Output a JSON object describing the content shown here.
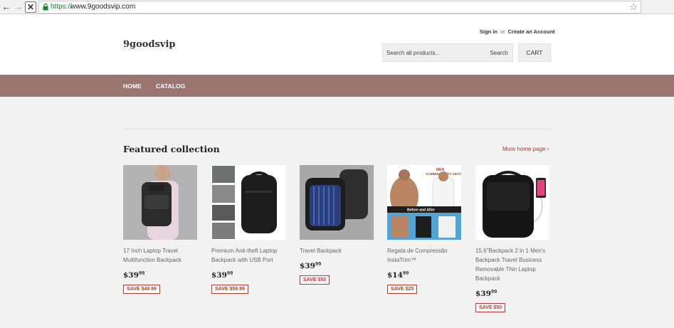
{
  "browser": {
    "url_scheme": "https://",
    "url_host": "www.9goodsvip.com",
    "back_icon": "back-arrow-icon",
    "forward_icon": "forward-arrow-icon",
    "stop_icon": "stop-icon",
    "bookmark_icon": "star-icon"
  },
  "header": {
    "logo": "9goodsvip",
    "sign_in": "Sign in",
    "or": "or",
    "create_account": "Create an Account",
    "search_placeholder": "Search all products...",
    "search_button": "Search",
    "cart": "CART"
  },
  "nav": {
    "items": [
      {
        "label": "HOME"
      },
      {
        "label": "CATALOG"
      }
    ],
    "background": "#9b7570"
  },
  "featured": {
    "title": "Featured collection",
    "more_link": "More home page ›",
    "products": [
      {
        "title": "17 Inch Laptop Travel Multifunction Backpack",
        "price_main": "$39",
        "price_cents": "99",
        "save": "SAVE $49.99"
      },
      {
        "title": "Premium Anti-theft Laptop Backpack with USB Port",
        "price_main": "$39",
        "price_cents": "99",
        "save": "SAVE $59.99"
      },
      {
        "title": "Travel Backpack",
        "price_main": "$39",
        "price_cents": "99",
        "save": "SAVE $50"
      },
      {
        "title": "Regata de Compressão InstaTrim™",
        "price_main": "$14",
        "price_cents": "99",
        "save": "SAVE $25"
      },
      {
        "title": "15.6\"Backpack 2 in 1 Men's Backpack Travel Business Removable Thin Laptop Backpack",
        "price_main": "$39",
        "price_cents": "99",
        "save": "SAVE $50"
      }
    ]
  },
  "image_text": {
    "vest_banner_top": "MEN",
    "vest_banner": "SLIMMING BODY VEST",
    "vest_before_after": "Before and After"
  },
  "colors": {
    "accent_red": "#c0392b",
    "nav_brown": "#9b7570"
  }
}
